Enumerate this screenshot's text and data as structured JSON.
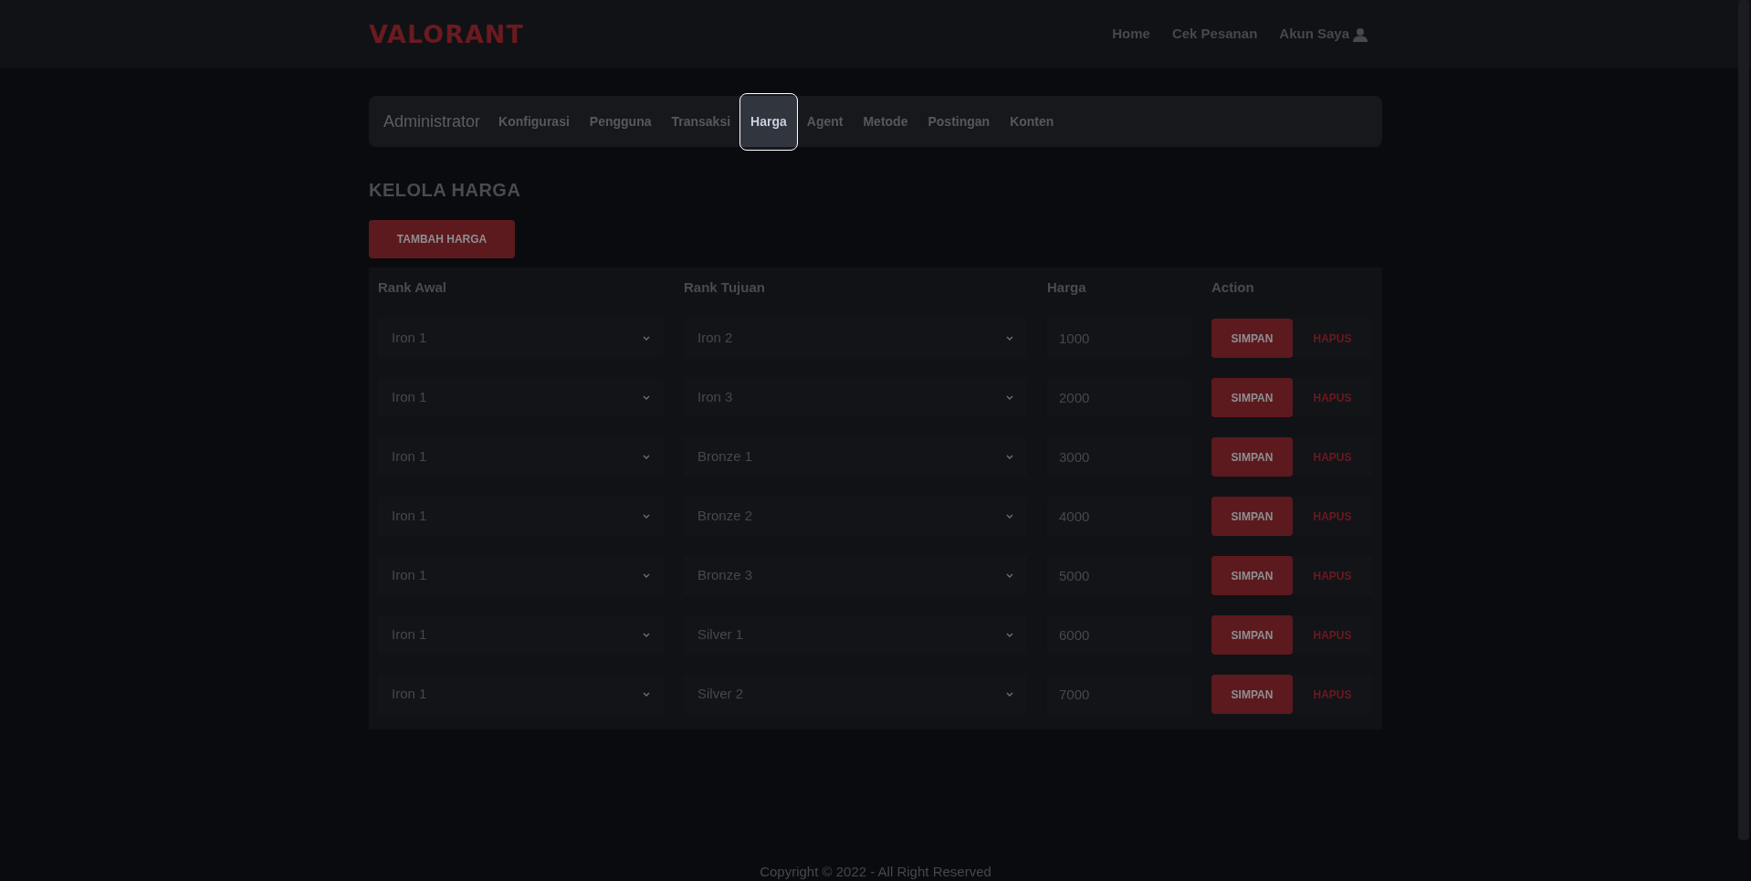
{
  "header": {
    "logo": "VALORANT",
    "links": [
      {
        "label": "Home"
      },
      {
        "label": "Cek Pesanan"
      },
      {
        "label": "Akun Saya"
      }
    ]
  },
  "admin_nav": {
    "title": "Administrator",
    "tabs": [
      {
        "label": "Konfigurasi",
        "selected": false
      },
      {
        "label": "Pengguna",
        "selected": false
      },
      {
        "label": "Transaksi",
        "selected": false
      },
      {
        "label": "Harga",
        "selected": true
      },
      {
        "label": "Agent",
        "selected": false
      },
      {
        "label": "Metode",
        "selected": false
      },
      {
        "label": "Postingan",
        "selected": false
      },
      {
        "label": "Konten",
        "selected": false
      }
    ]
  },
  "heading": "KELOLA HARGA",
  "add_button": "TAMBAH HARGA",
  "table": {
    "columns": [
      "Rank Awal",
      "Rank Tujuan",
      "Harga",
      "Action"
    ],
    "rows": [
      {
        "rank_awal": "Iron 1",
        "rank_tujuan": "Iron 2",
        "harga": "1000",
        "save": "SIMPAN",
        "delete": "HAPUS"
      },
      {
        "rank_awal": "Iron 1",
        "rank_tujuan": "Iron 3",
        "harga": "2000",
        "save": "SIMPAN",
        "delete": "HAPUS"
      },
      {
        "rank_awal": "Iron 1",
        "rank_tujuan": "Bronze 1",
        "harga": "3000",
        "save": "SIMPAN",
        "delete": "HAPUS"
      },
      {
        "rank_awal": "Iron 1",
        "rank_tujuan": "Bronze 2",
        "harga": "4000",
        "save": "SIMPAN",
        "delete": "HAPUS"
      },
      {
        "rank_awal": "Iron 1",
        "rank_tujuan": "Bronze 3",
        "harga": "5000",
        "save": "SIMPAN",
        "delete": "HAPUS"
      },
      {
        "rank_awal": "Iron 1",
        "rank_tujuan": "Silver 1",
        "harga": "6000",
        "save": "SIMPAN",
        "delete": "HAPUS"
      },
      {
        "rank_awal": "Iron 1",
        "rank_tujuan": "Silver 2",
        "harga": "7000",
        "save": "SIMPAN",
        "delete": "HAPUS"
      }
    ]
  },
  "footer": "Copyright © 2022 - All Right Reserved"
}
